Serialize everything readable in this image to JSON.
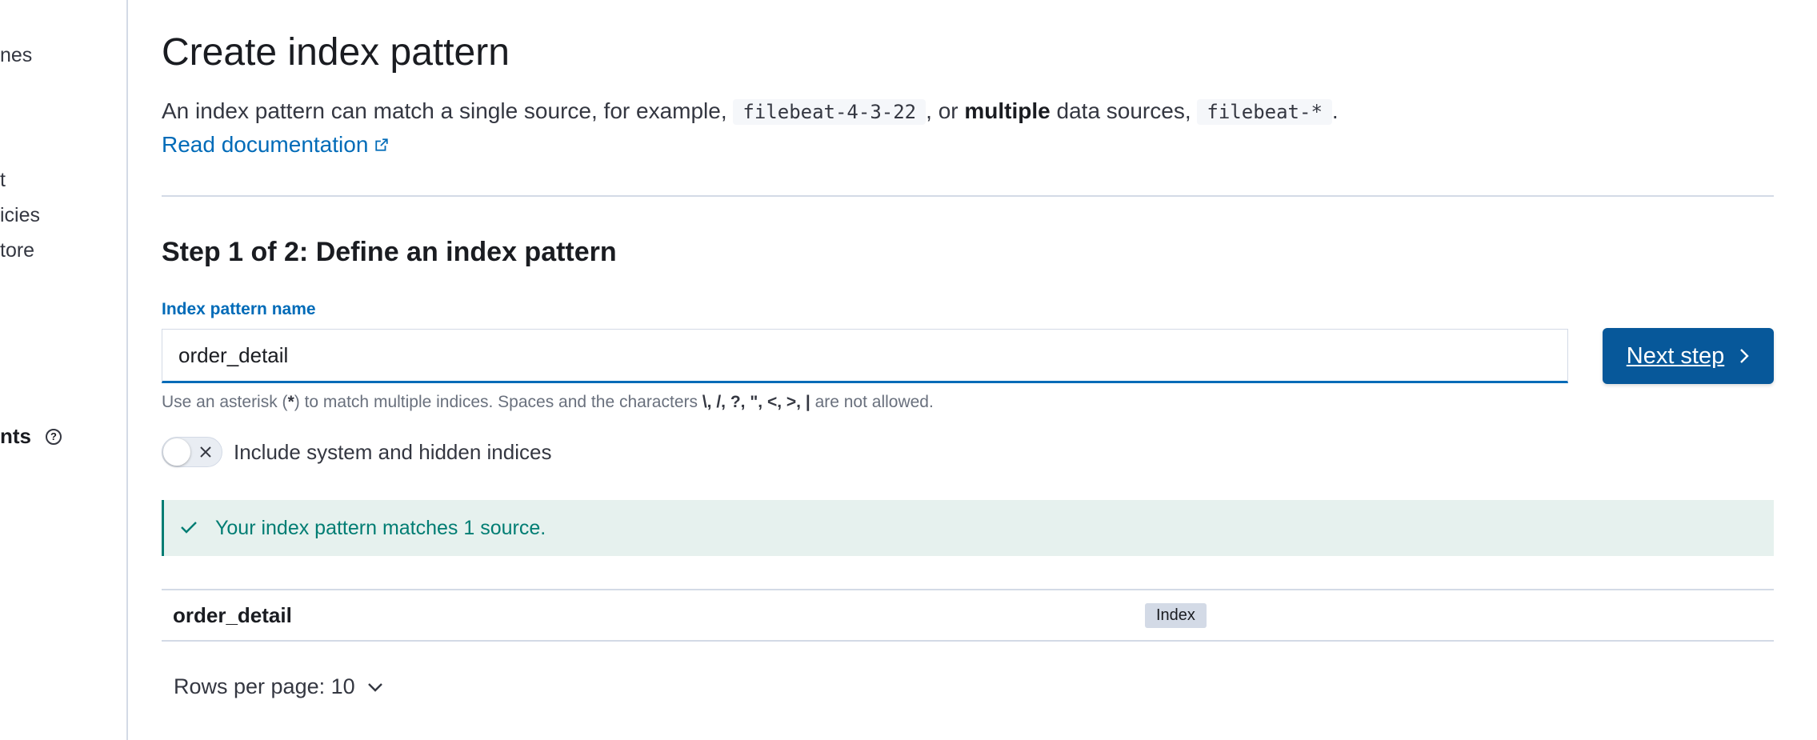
{
  "sidebar": {
    "items": [
      {
        "label": "nes"
      },
      {
        "label": "t"
      },
      {
        "label": "icies"
      },
      {
        "label": "tore"
      }
    ],
    "section_heading": "nts"
  },
  "header": {
    "title": "Create index pattern",
    "description": {
      "part1": "An index pattern can match a single source, for example,",
      "code1": "filebeat-4-3-22",
      "part2": ", or",
      "bold": "multiple",
      "part3": "data sources,",
      "code2": "filebeat-*",
      "part4": "."
    },
    "doc_link_label": "Read documentation"
  },
  "step": {
    "title": "Step 1 of 2: Define an index pattern",
    "field_label": "Index pattern name",
    "input_value": "order_detail",
    "next_button_label": "Next step",
    "help_text": {
      "part1": "Use an asterisk (",
      "asterisk": "*",
      "part2": ") to match multiple indices. Spaces and the characters",
      "chars": "\\, /, ?, \", <, >, |",
      "part3": "are not allowed."
    },
    "toggle_label": "Include system and hidden indices",
    "toggle_on": false
  },
  "callout": {
    "message": "Your index pattern matches 1 source.",
    "color": "#017d73"
  },
  "table": {
    "rows": [
      {
        "name": "order_detail",
        "badge": "Index"
      }
    ],
    "rows_per_page_label": "Rows per page: 10"
  },
  "colors": {
    "primary": "#07589a",
    "link": "#006bb8",
    "success": "#017d73"
  }
}
